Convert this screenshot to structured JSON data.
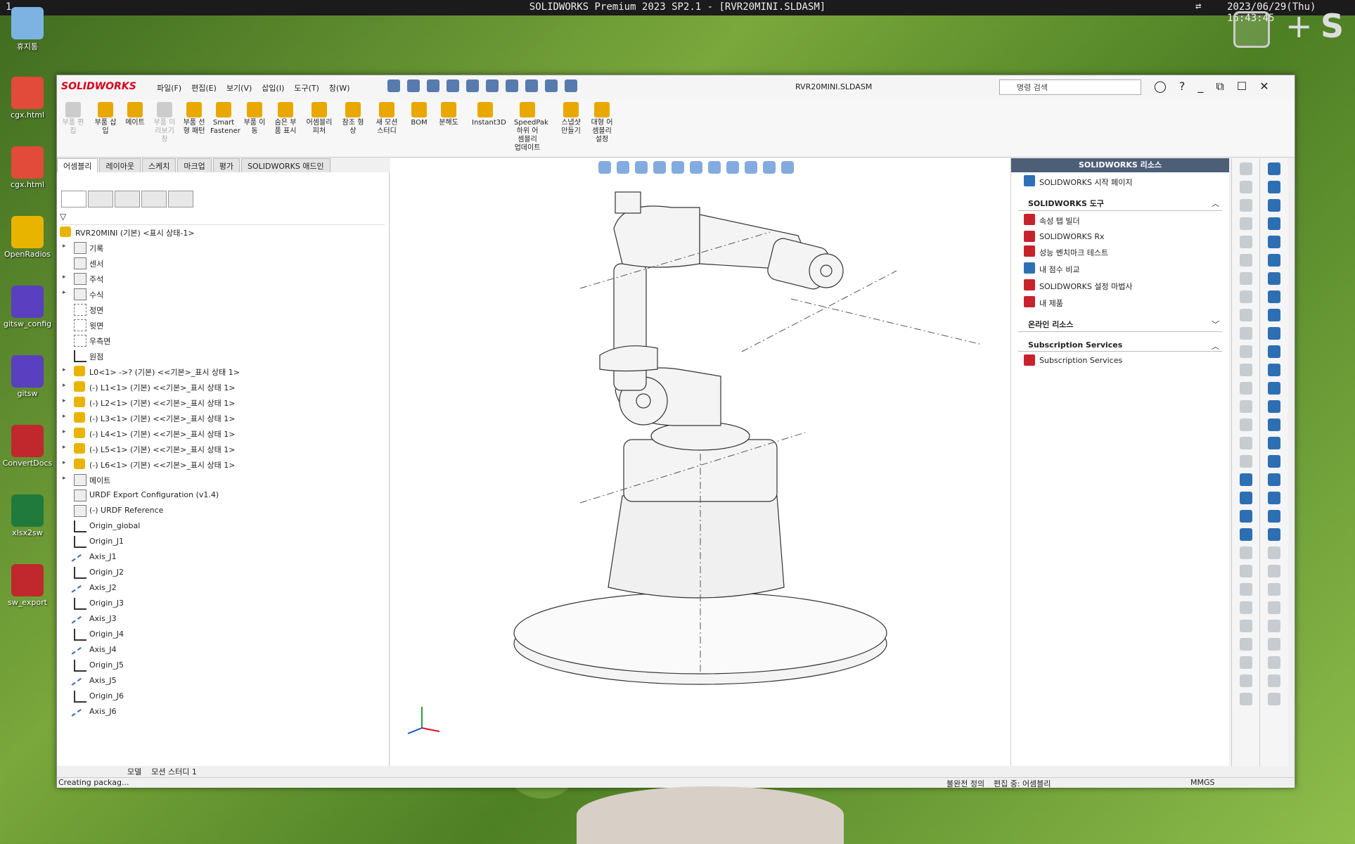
{
  "top": {
    "num": "1",
    "title": "SOLIDWORKS Premium 2023 SP2.1 - [RVR20MINI.SLDASM]",
    "datetime": "2023/06/29(Thu) 16:43:45"
  },
  "desktop": [
    "휴지통",
    "cgx.html",
    "cgx.html",
    "OpenRadios",
    "gitsw_config",
    "gitsw",
    "ConvertDocs",
    "xlsx2sw",
    "sw_export"
  ],
  "sw": {
    "logo": "SOLIDWORKS",
    "menus": [
      "파일(F)",
      "편집(E)",
      "보기(V)",
      "삽입(I)",
      "도구(T)",
      "창(W)"
    ],
    "doc": "RVR20MINI.SLDASM",
    "search_placeholder": "명령 검색",
    "ribbon": [
      {
        "label": "부품 편집",
        "dim": true
      },
      {
        "label": "부품 삽입"
      },
      {
        "label": "메이트"
      },
      {
        "label": "부품 미리보기 창",
        "dim": true
      },
      {
        "label": "부품 선형 패턴"
      },
      {
        "label": "Smart Fastener"
      },
      {
        "label": "부품 이동"
      },
      {
        "label": "숨은 부품 표시"
      },
      {
        "label": "어셈블리 피처"
      },
      {
        "label": "참조 형상"
      },
      {
        "label": "새 모션 스터디"
      },
      {
        "label": "BOM"
      },
      {
        "label": "분해도"
      },
      {
        "label": "Instant3D"
      },
      {
        "label": "SpeedPak 하위 어셈블리 업데이트"
      },
      {
        "label": "스냅샷 만들기"
      },
      {
        "label": "대형 어셈블리 설정"
      }
    ],
    "tabs": [
      "어셈블리",
      "레이아웃",
      "스케치",
      "마크업",
      "평가",
      "SOLIDWORKS 애드인"
    ],
    "tree": [
      {
        "t": "RVR20MINI (기본) <표시 상태-1>",
        "ic": "part",
        "lvl": 0
      },
      {
        "t": "기록",
        "ic": "box",
        "lvl": 1,
        "exp": true
      },
      {
        "t": "센서",
        "ic": "box",
        "lvl": 1
      },
      {
        "t": "주석",
        "ic": "box",
        "lvl": 1,
        "exp": true
      },
      {
        "t": "수식",
        "ic": "box",
        "lvl": 1,
        "exp": true
      },
      {
        "t": "정면",
        "ic": "plane",
        "lvl": 1
      },
      {
        "t": "윗면",
        "ic": "plane",
        "lvl": 1
      },
      {
        "t": "우측면",
        "ic": "plane",
        "lvl": 1
      },
      {
        "t": "원점",
        "ic": "origin",
        "lvl": 1
      },
      {
        "t": "L0<1> ->? (기본) <<기본>_표시 상태 1>",
        "ic": "part",
        "lvl": 1,
        "exp": true
      },
      {
        "t": "(-) L1<1> (기본) <<기본>_표시 상태 1>",
        "ic": "part",
        "lvl": 1,
        "exp": true
      },
      {
        "t": "(-) L2<1> (기본) <<기본>_표시 상태 1>",
        "ic": "part",
        "lvl": 1,
        "exp": true
      },
      {
        "t": "(-) L3<1> (기본) <<기본>_표시 상태 1>",
        "ic": "part",
        "lvl": 1,
        "exp": true
      },
      {
        "t": "(-) L4<1> (기본) <<기본>_표시 상태 1>",
        "ic": "part",
        "lvl": 1,
        "exp": true
      },
      {
        "t": "(-) L5<1> (기본) <<기본>_표시 상태 1>",
        "ic": "part",
        "lvl": 1,
        "exp": true
      },
      {
        "t": "(-) L6<1> (기본) <<기본>_표시 상태 1>",
        "ic": "part",
        "lvl": 1,
        "exp": true
      },
      {
        "t": "메이트",
        "ic": "box",
        "lvl": 1,
        "exp": true
      },
      {
        "t": "URDF Export Configuration (v1.4)",
        "ic": "box",
        "lvl": 1
      },
      {
        "t": "(-) URDF Reference",
        "ic": "box",
        "lvl": 1
      },
      {
        "t": "Origin_global",
        "ic": "origin",
        "lvl": 1
      },
      {
        "t": "Origin_J1",
        "ic": "origin",
        "lvl": 1
      },
      {
        "t": "Axis_J1",
        "ic": "axis",
        "lvl": 1
      },
      {
        "t": "Origin_J2",
        "ic": "origin",
        "lvl": 1
      },
      {
        "t": "Axis_J2",
        "ic": "axis",
        "lvl": 1
      },
      {
        "t": "Origin_J3",
        "ic": "origin",
        "lvl": 1
      },
      {
        "t": "Axis_J3",
        "ic": "axis",
        "lvl": 1
      },
      {
        "t": "Origin_J4",
        "ic": "origin",
        "lvl": 1
      },
      {
        "t": "Axis_J4",
        "ic": "axis",
        "lvl": 1
      },
      {
        "t": "Origin_J5",
        "ic": "origin",
        "lvl": 1
      },
      {
        "t": "Axis_J5",
        "ic": "axis",
        "lvl": 1
      },
      {
        "t": "Origin_J6",
        "ic": "origin",
        "lvl": 1
      },
      {
        "t": "Axis_J6",
        "ic": "axis",
        "lvl": 1
      }
    ],
    "bottom_tabs": [
      "모델",
      "모션 스터디 1"
    ],
    "status": {
      "left": "Creating packag...",
      "mid1": "불완전 정의",
      "mid2": "편집 중: 어셈블리",
      "units": "MMGS"
    },
    "resources": {
      "title": "SOLIDWORKS 리소스",
      "start": "SOLIDWORKS 시작 페이지",
      "tools_header": "SOLIDWORKS 도구",
      "tools": [
        "속성 탭 빌더",
        "SOLIDWORKS Rx",
        "성능 벤치마크 테스트",
        "내 점수 비교",
        "SOLIDWORKS 설정 마법사",
        "내 제품"
      ],
      "online": "온라인 리소스",
      "subs_header": "Subscription Services",
      "subs": "Subscription Services"
    }
  }
}
